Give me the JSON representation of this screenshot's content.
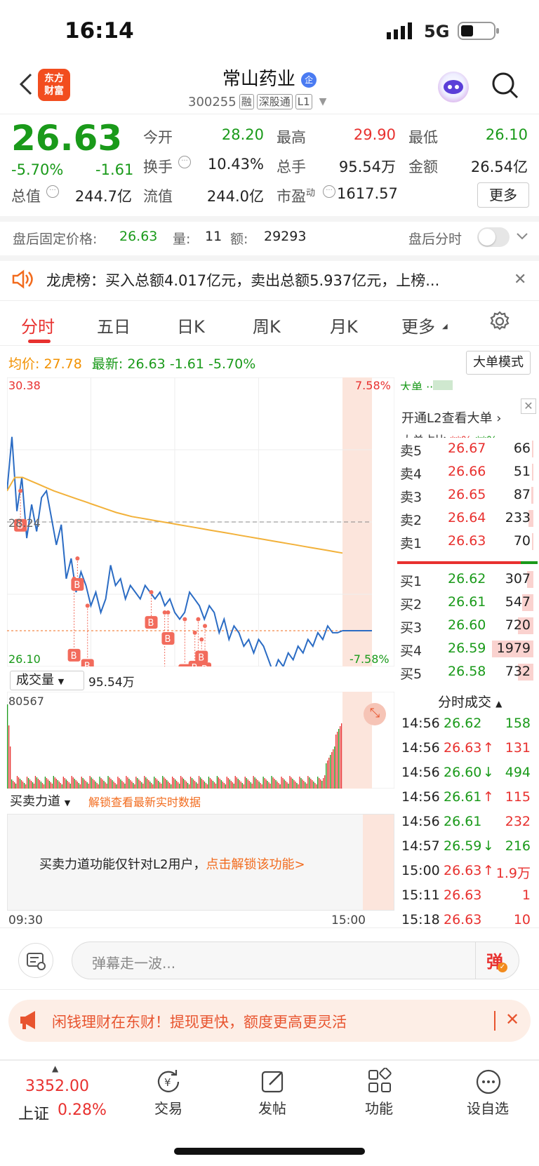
{
  "status_bar": {
    "time": "16:14",
    "network": "5G"
  },
  "header": {
    "stock_name": "常山药业",
    "badge": "企",
    "code": "300255",
    "tags": [
      "融",
      "深股通",
      "L1"
    ],
    "logo_text": "东方\n财富"
  },
  "quote": {
    "price": "26.63",
    "change_pct": "-5.70%",
    "change": "-1.61",
    "open_label": "今开",
    "open": "28.20",
    "high_label": "最高",
    "high": "29.90",
    "low_label": "最低",
    "low": "26.10",
    "turnover_label": "换手",
    "turnover": "10.43%",
    "volume_label": "总手",
    "volume": "95.54万",
    "amount_label": "金额",
    "amount": "26.54亿",
    "mktcap_label": "总值",
    "mktcap": "244.7亿",
    "float_label": "流值",
    "float": "244.0亿",
    "pe_label": "市盈",
    "pe_sup": "动",
    "pe": "1617.57",
    "more_label": "更多"
  },
  "after_hours": {
    "label": "盘后固定价格:",
    "price": "26.63",
    "vol_label": "量:",
    "vol": "11",
    "amt_label": "额:",
    "amt": "29293",
    "toggle_label": "盘后分时"
  },
  "notice": {
    "text": "龙虎榜：买入总额4.017亿元，卖出总额5.937亿元，上榜..."
  },
  "tabs": [
    "分时",
    "五日",
    "日K",
    "周K",
    "月K",
    "更多"
  ],
  "summary": {
    "avg_label": "均价:",
    "avg": "27.78",
    "latest_label": "最新:",
    "latest": "26.63",
    "chg": "-1.61",
    "pct": "-5.70%",
    "bigorder_btn": "大单模式"
  },
  "chart_data": {
    "type": "line",
    "y_top": "30.38",
    "y_mid": "28.24",
    "y_bottom": "26.10",
    "pct_top": "7.58%",
    "pct_bottom": "-7.58%",
    "x_start": "09:30",
    "x_end": "15:00",
    "ylim": [
      26.1,
      30.38
    ],
    "price": [
      28.7,
      29.5,
      28.4,
      28.9,
      28.0,
      28.5,
      28.1,
      28.6,
      28.7,
      28.3,
      27.9,
      28.2,
      27.4,
      27.7,
      27.2,
      27.5,
      27.3,
      27.0,
      27.2,
      26.9,
      27.1,
      27.6,
      27.3,
      27.4,
      27.1,
      27.3,
      27.2,
      27.1,
      27.3,
      27.2,
      27.1,
      27.2,
      27.0,
      27.1,
      26.9,
      26.8,
      26.9,
      27.2,
      27.1,
      27.0,
      26.8,
      27.0,
      26.9,
      26.6,
      26.8,
      26.5,
      26.7,
      26.6,
      26.4,
      26.5,
      26.3,
      26.5,
      26.4,
      26.2,
      26.0,
      26.2,
      26.1,
      26.3,
      26.2,
      26.4,
      26.3,
      26.5,
      26.4,
      26.6,
      26.5,
      26.7,
      26.6,
      26.6,
      26.63
    ],
    "avg": [
      28.7,
      28.9,
      28.9,
      28.85,
      28.8,
      28.75,
      28.7,
      28.66,
      28.62,
      28.58,
      28.54,
      28.5,
      28.46,
      28.42,
      28.38,
      28.35,
      28.32,
      28.3,
      28.28,
      28.26,
      28.24,
      28.22,
      28.2,
      28.18,
      28.16,
      28.14,
      28.12,
      28.1,
      28.08,
      28.06,
      28.04,
      28.02,
      28.0,
      27.98,
      27.96,
      27.94,
      27.92,
      27.9,
      27.88,
      27.86,
      27.84,
      27.82,
      27.8,
      27.78
    ],
    "volume_max": "80567",
    "volume_label": "成交量",
    "volume_total": "95.54万"
  },
  "force": {
    "label": "买卖力道",
    "unlock": "解锁查看最新实时数据",
    "msg": "买卖力道功能仅针对L2用户，",
    "link": "点击解锁该功能>"
  },
  "order_book": {
    "l2_text": "开通L2查看大单",
    "sells": [
      {
        "l": "卖5",
        "p": "26.67",
        "v": "66"
      },
      {
        "l": "卖4",
        "p": "26.66",
        "v": "51"
      },
      {
        "l": "卖3",
        "p": "26.65",
        "v": "87"
      },
      {
        "l": "卖2",
        "p": "26.64",
        "v": "233"
      },
      {
        "l": "卖1",
        "p": "26.63",
        "v": "70"
      }
    ],
    "buys": [
      {
        "l": "买1",
        "p": "26.62",
        "v": "307"
      },
      {
        "l": "买2",
        "p": "26.61",
        "v": "547"
      },
      {
        "l": "买3",
        "p": "26.60",
        "v": "720"
      },
      {
        "l": "买4",
        "p": "26.59",
        "v": "1979"
      },
      {
        "l": "买5",
        "p": "26.58",
        "v": "732"
      }
    ]
  },
  "ticks": {
    "title": "分时成交",
    "rows": [
      {
        "t": "14:56",
        "p": "26.62",
        "a": "",
        "v": "158",
        "c": "green"
      },
      {
        "t": "14:56",
        "p": "26.63",
        "a": "↑",
        "v": "131",
        "c": "red"
      },
      {
        "t": "14:56",
        "p": "26.60",
        "a": "↓",
        "v": "494",
        "c": "green"
      },
      {
        "t": "14:56",
        "p": "26.61",
        "a": "↑",
        "v": "115",
        "c": "red"
      },
      {
        "t": "14:56",
        "p": "26.61",
        "a": "",
        "v": "232",
        "c": "red"
      },
      {
        "t": "14:57",
        "p": "26.59",
        "a": "↓",
        "v": "216",
        "c": "green"
      },
      {
        "t": "15:00",
        "p": "26.63",
        "a": "↑",
        "v": "1.9万",
        "c": "red"
      },
      {
        "t": "15:11",
        "p": "26.63",
        "a": "",
        "v": "1",
        "c": "red"
      },
      {
        "t": "15:18",
        "p": "26.63",
        "a": "",
        "v": "10",
        "c": "red"
      }
    ]
  },
  "comment": {
    "placeholder": "弹幕走一波...",
    "btn": "弹"
  },
  "ad": {
    "text": "闲钱理财在东财！提现更快，额度更高更灵活"
  },
  "bottom_nav": {
    "index_value": "3352.00",
    "index_name": "上证",
    "index_pct": "0.28%",
    "items": [
      "交易",
      "发帖",
      "功能",
      "设自选"
    ]
  }
}
